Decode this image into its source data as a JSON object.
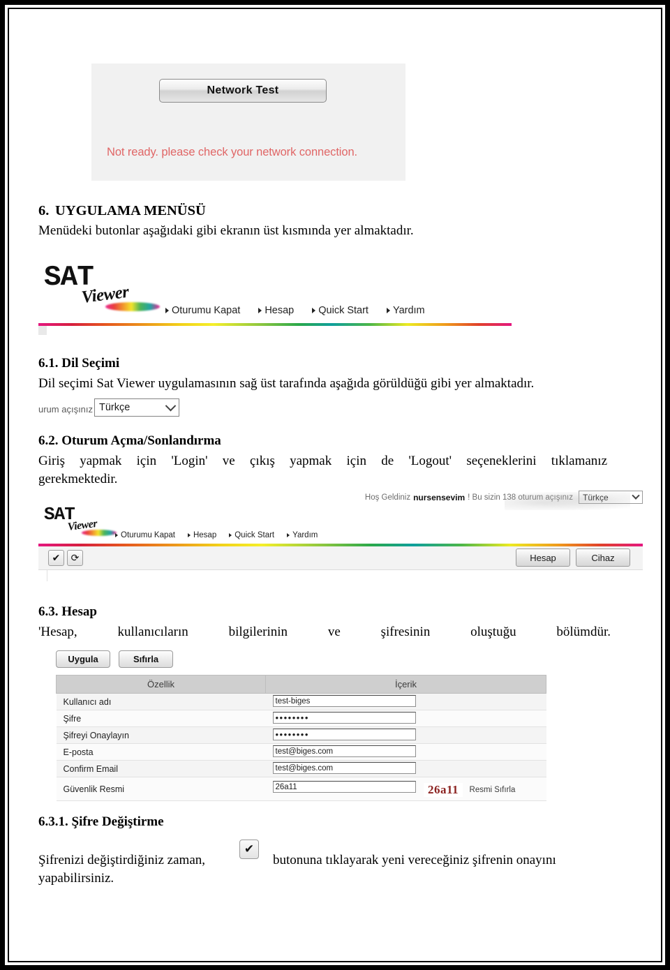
{
  "figures": {
    "network_test": {
      "button_label": "Network Test",
      "status_text": "Not ready. please check your network connection."
    },
    "menu_bar": {
      "logo_main": "SAT",
      "logo_sub": "Viewer",
      "items": [
        {
          "label": "Oturumu Kapat"
        },
        {
          "label": "Hesap"
        },
        {
          "label": "Quick Start"
        },
        {
          "label": "Yardım"
        }
      ]
    },
    "language_select": {
      "prefix_text": "urum açışınız",
      "value": "Türkçe"
    },
    "logged_in_header": {
      "welcome_prefix": "Hoş Geldiniz",
      "username": "nursensevim",
      "welcome_suffix": "! Bu sizin 138 oturum açışınız",
      "language_value": "Türkçe",
      "toolbar_left": [
        {
          "name": "apply-check",
          "glyph": "✔"
        },
        {
          "name": "refresh",
          "glyph": "⟳"
        }
      ],
      "toolbar_right": [
        {
          "label": "Hesap"
        },
        {
          "label": "Cihaz"
        }
      ]
    },
    "account_panel": {
      "apply_label": "Uygula",
      "reset_label": "Sıfırla",
      "col_property": "Özellik",
      "col_content": "İçerik",
      "rows": [
        {
          "property": "Kullanıcı adı",
          "value": "test-biges",
          "kind": "text"
        },
        {
          "property": "Şifre",
          "value": "••••••••",
          "kind": "password"
        },
        {
          "property": "Şifreyi Onaylayın",
          "value": "••••••••",
          "kind": "password"
        },
        {
          "property": "E-posta",
          "value": "test@biges.com",
          "kind": "text"
        },
        {
          "property": "Confirm Email",
          "value": "test@biges.com",
          "kind": "text"
        },
        {
          "property": "Güvenlik Resmi",
          "value": "26a11",
          "kind": "captcha",
          "captcha_image_text": "26a11",
          "captcha_reset_label": "Resmi Sıfırla"
        }
      ]
    },
    "inline_check_button": {
      "glyph": "✔"
    }
  },
  "sections": {
    "s6": {
      "number": "6.",
      "title": "UYGULAMA MENÜSÜ",
      "body": "Menüdeki butonlar aşağıdaki gibi ekranın üst kısmında yer almaktadır."
    },
    "s61": {
      "number": "6.1.",
      "title": "Dil Seçimi",
      "body": "Dil seçimi Sat Viewer uygulamasının sağ üst tarafında aşağıda görüldüğü gibi yer almaktadır."
    },
    "s62": {
      "number": "6.2.",
      "title": "Oturum Açma/Sonlandırma",
      "body_line1": "Giriş yapmak için 'Login' ve çıkış yapmak için de 'Logout' seçeneklerini tıklamanız",
      "body_line2": "gerekmektedir."
    },
    "s63": {
      "number": "6.3.",
      "title": "Hesap",
      "body": "'Hesap, kullanıcıların bilgilerinin ve şifresinin oluştuğu bölümdür."
    },
    "s631": {
      "number": "6.3.1.",
      "title": "Şifre Değiştirme",
      "body_before": "Şifrenizi değiştirdiğiniz zaman,",
      "body_after": "butonuna tıklayarak yeni vereceğiniz şifrenin onayını",
      "body_line2": "yapabilirsiniz."
    }
  },
  "colors": {
    "error_red": "#e06666",
    "captcha_red": "#8b2220",
    "rainbow_start": "#e4177f",
    "rainbow_mid": "#0e9f9c"
  }
}
